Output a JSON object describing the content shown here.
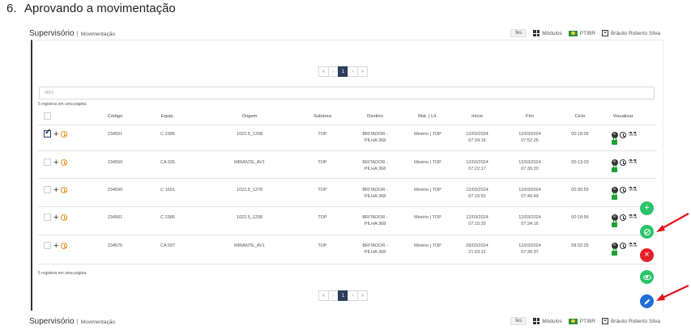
{
  "doc_heading": {
    "number": "6.",
    "text": "Aprovando a movimentação"
  },
  "topbar": {
    "brand": "Supervisório",
    "separator": "|",
    "page": "Movimentação",
    "fes": "fes",
    "modules": "Módulos",
    "language": "PT/BR",
    "user": "Bráulio Roberto Silva"
  },
  "pagination": {
    "first": "«",
    "prev": "‹",
    "current": "1",
    "next": "›",
    "last": "»"
  },
  "filter": {
    "placeholder": "filtro",
    "value": ""
  },
  "records_info": "5 registros em uma página.",
  "table": {
    "headers": [
      "Código",
      "Equip.",
      "Origem",
      "Subárea",
      "Destino",
      "Mat. | Lit.",
      "Início",
      "Fim",
      "Ciclo",
      "Visualizar"
    ],
    "rows": [
      {
        "checked": true,
        "codigo": "234591",
        "equip": "C 2386",
        "origem": "1022.5_1208",
        "subarea": "TOP",
        "destino_1": "BRITADOR -",
        "destino_2": "PILHA 368",
        "material": "Minério | TOP",
        "inicio_data": "12/03/2024",
        "inicio_hora": "07:34:16",
        "fim_data": "12/03/2024",
        "fim_hora": "07:52:25",
        "ciclo": "00:18:09"
      },
      {
        "checked": false,
        "codigo": "234550",
        "equip": "CA 035",
        "origem": "MIRANTE_AV1",
        "subarea": "TOP",
        "destino_1": "BRITADOR -",
        "destino_2": "PILHA 368",
        "material": "Minério | TOP",
        "inicio_data": "12/03/2024",
        "inicio_hora": "07:22:17",
        "fim_data": "12/03/2024",
        "fim_hora": "07:36:20",
        "ciclo": "00:13:03"
      },
      {
        "checked": false,
        "codigo": "234590",
        "equip": "C 1651",
        "origem": "1022.5_1278",
        "subarea": "TOP",
        "destino_1": "BRITADOR -",
        "destino_2": "PILHA 368",
        "material": "Minério | TOP",
        "inicio_data": "12/03/2024",
        "inicio_hora": "07:15:50",
        "fim_data": "12/03/2024",
        "fim_hora": "07:46:49",
        "ciclo": "00:30:59"
      },
      {
        "checked": false,
        "codigo": "234581",
        "equip": "C 2386",
        "origem": "1022.5_1208",
        "subarea": "TOP",
        "destino_1": "BRITADOR -",
        "destino_2": "PILHA 368",
        "material": "Minério | TOP",
        "inicio_data": "12/03/2024",
        "inicio_hora": "07:15:20",
        "fim_data": "12/03/2024",
        "fim_hora": "07:34:16",
        "ciclo": "00:18:56"
      },
      {
        "checked": false,
        "codigo": "234575",
        "equip": "CA 037",
        "origem": "MIRANTE_AV1",
        "subarea": "TOP",
        "destino_1": "BRITADOR -",
        "destino_2": "PILHA 368",
        "material": "Minério | TOP",
        "inicio_data": "09/03/2024",
        "inicio_hora": "21:03:12",
        "fim_data": "12/03/2024",
        "fim_hora": "07:36:37",
        "ciclo": "58:32:25"
      }
    ]
  },
  "fabs": {
    "add": "+",
    "reject": "×"
  },
  "colors": {
    "accent_green": "#2cc46a",
    "reject_red": "#e5202b",
    "edit_blue": "#1f6fd6",
    "arrow_red": "#e3131b",
    "nav_dark": "#2e3d5a"
  }
}
